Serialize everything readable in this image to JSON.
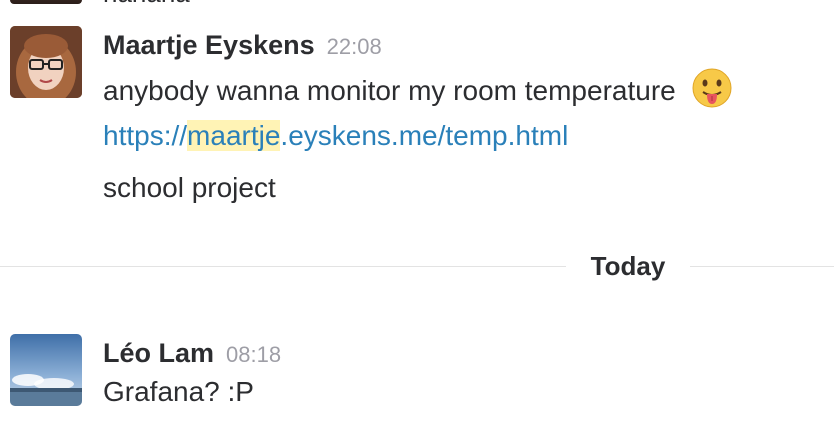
{
  "previous_message": {
    "text": "hahaha"
  },
  "messages": [
    {
      "sender": "Maartje Eyskens",
      "time": "22:08",
      "lines": [
        "anybody wanna monitor my room temperature"
      ],
      "emoji": "stuck-out-tongue-icon",
      "link": {
        "prefix": "https://",
        "highlight": "maartje",
        "suffix": ".eyskens.me/temp.html"
      },
      "extra_line": "school project"
    },
    {
      "sender": "Léo Lam",
      "time": "08:18",
      "lines": [
        "Grafana? :P"
      ]
    }
  ],
  "day_divider": {
    "label": "Today"
  },
  "colors": {
    "link": "#2a80b9",
    "highlight": "#fff3b5",
    "timestamp": "#9e9ea6",
    "text": "#2c2d30"
  }
}
